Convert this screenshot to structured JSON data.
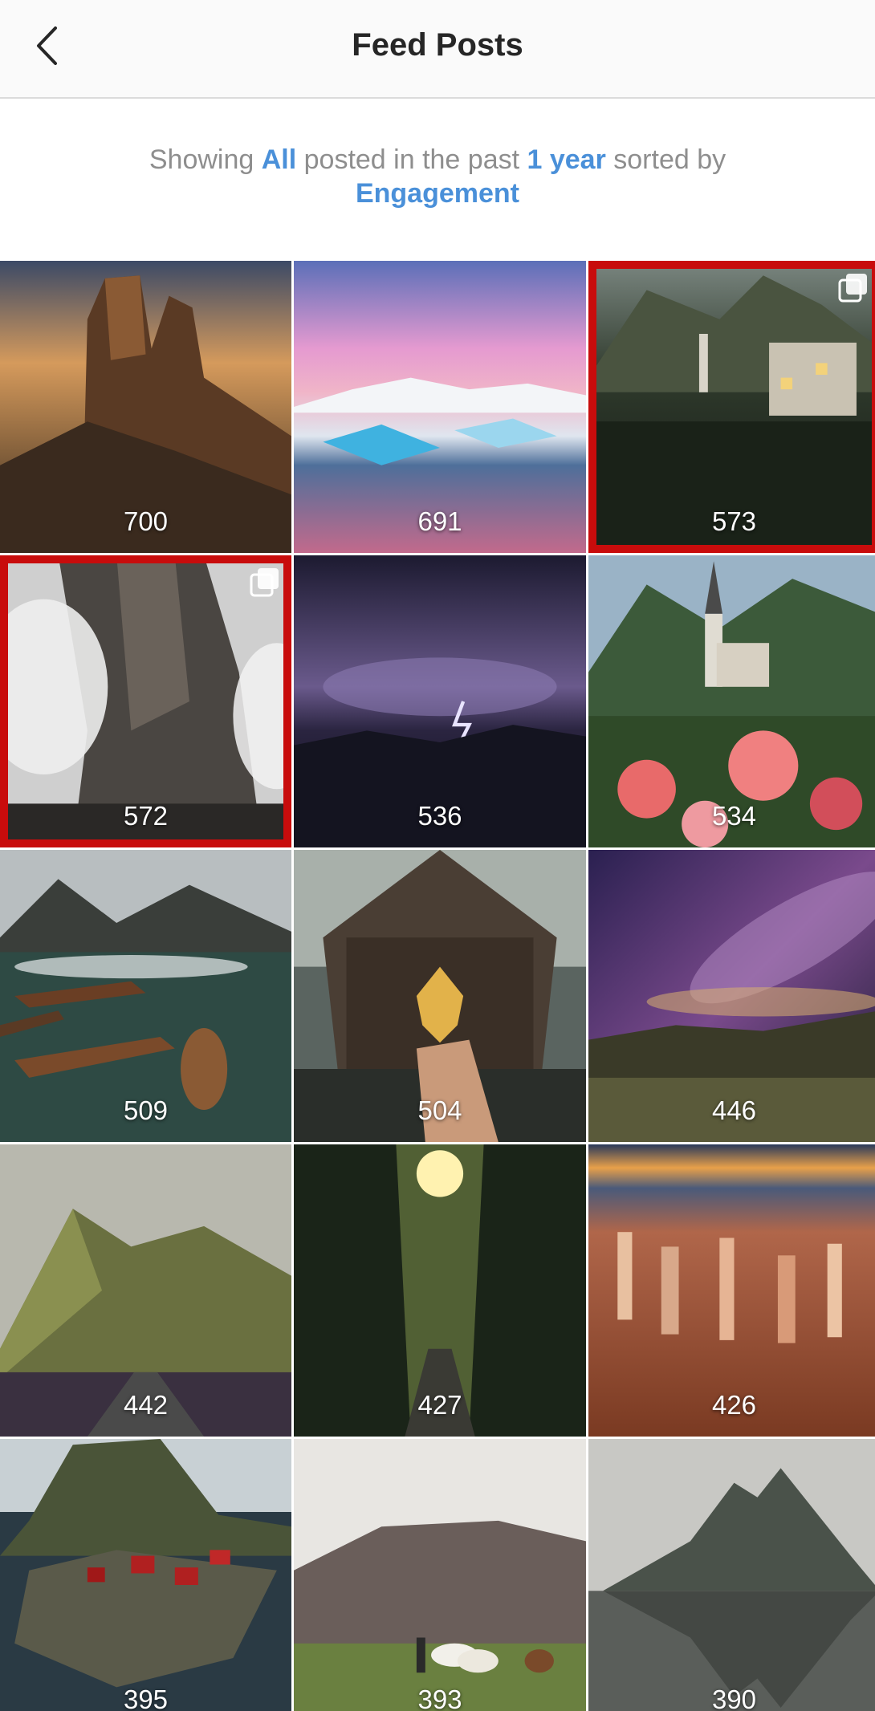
{
  "header": {
    "title": "Feed Posts",
    "back_icon": "chevron-left-icon"
  },
  "filter": {
    "prefix": "Showing ",
    "type": "All",
    "middle": " posted in the past ",
    "period": "1 year",
    "suffix": " sorted by",
    "sort": "Engagement"
  },
  "colors": {
    "link": "#4a90d9",
    "highlight_border": "#c80c0c",
    "header_bg": "#fafafa"
  },
  "posts": [
    {
      "count": "700",
      "subject": "mountain peaks at sunset",
      "highlighted": true,
      "multi": false
    },
    {
      "count": "691",
      "subject": "pink sky over glacier lagoon",
      "highlighted": false,
      "multi": false
    },
    {
      "count": "573",
      "subject": "lakeside village at night",
      "highlighted": true,
      "multi": true
    },
    {
      "count": "572",
      "subject": "misty cliff",
      "highlighted": true,
      "multi": true
    },
    {
      "count": "536",
      "subject": "lightning storm at night",
      "highlighted": false,
      "multi": false
    },
    {
      "count": "534",
      "subject": "alpine church with flowers",
      "highlighted": false,
      "multi": false
    },
    {
      "count": "509",
      "subject": "rowboats on lake",
      "highlighted": false,
      "multi": false
    },
    {
      "count": "504",
      "subject": "hand holding leaf by boathouse",
      "highlighted": false,
      "multi": false
    },
    {
      "count": "446",
      "subject": "milky way over lake",
      "highlighted": false,
      "multi": false
    },
    {
      "count": "442",
      "subject": "mountain road",
      "highlighted": false,
      "multi": false
    },
    {
      "count": "427",
      "subject": "forest road with sun",
      "highlighted": false,
      "multi": false
    },
    {
      "count": "426",
      "subject": "canyon hoodoos",
      "highlighted": false,
      "multi": false
    },
    {
      "count": "395",
      "subject": "fishing village by mountain",
      "highlighted": false,
      "multi": false
    },
    {
      "count": "393",
      "subject": "horses in field",
      "highlighted": false,
      "multi": false
    },
    {
      "count": "390",
      "subject": "mountain reflected in lake",
      "highlighted": false,
      "multi": false
    }
  ]
}
